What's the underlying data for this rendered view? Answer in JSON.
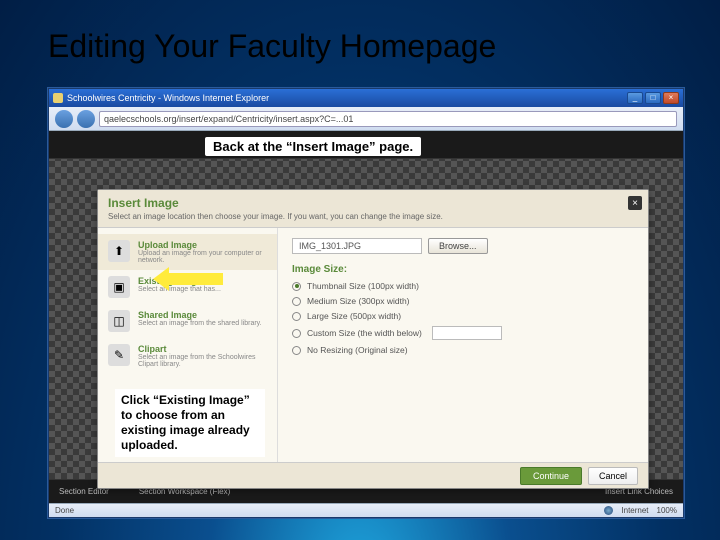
{
  "slide": {
    "title": "Editing Your Faculty Homepage"
  },
  "browser": {
    "window_title": "Schoolwires Centricity - Windows Internet Explorer",
    "address": "qaelecschools.org/insert/expand/Centricity/insert.aspx?C=...01",
    "status_left": "Done",
    "status_net": "Internet",
    "status_zoom": "100%"
  },
  "callouts": {
    "top": "Back at the “Insert Image” page.",
    "box": "Click “Existing Image” to choose from an existing image already uploaded."
  },
  "modal": {
    "title": "Insert Image",
    "subtitle": "Select an image location then choose your image. If you want, you can change the image size.",
    "options": [
      {
        "title": "Upload Image",
        "sub": "Upload an image from your computer or network."
      },
      {
        "title": "Existing Image",
        "sub": "Select an image that has..."
      },
      {
        "title": "Shared Image",
        "sub": "Select an image from the shared library."
      },
      {
        "title": "Clipart",
        "sub": "Select an image from the Schoolwires Clipart library."
      }
    ],
    "file_value": "IMG_1301.JPG",
    "browse": "Browse...",
    "size_label": "Image Size:",
    "sizes": [
      {
        "label": "Thumbnail Size (100px width)",
        "checked": true
      },
      {
        "label": "Medium Size (300px width)",
        "checked": false
      },
      {
        "label": "Large Size (500px width)",
        "checked": false
      },
      {
        "label": "Custom Size (the width below)",
        "checked": false
      },
      {
        "label": "No Resizing (Original size)",
        "checked": false
      }
    ],
    "continue": "Continue",
    "cancel": "Cancel"
  },
  "bottom_bar": {
    "a": "Section Editor",
    "b": "Section Workspace (Flex)",
    "c": "Insert Link Choices"
  }
}
